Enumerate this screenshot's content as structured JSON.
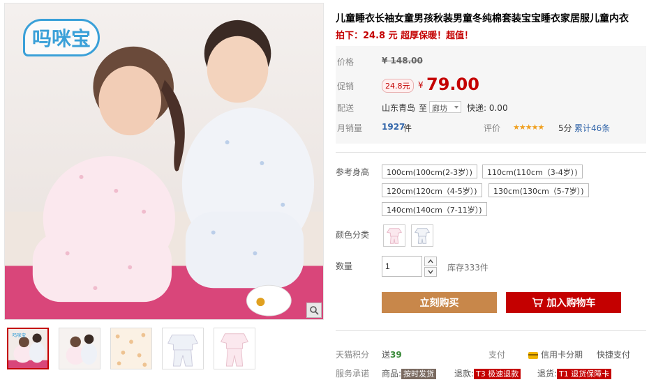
{
  "product": {
    "title": "儿童睡衣长袖女童男孩秋装男童冬纯棉套装宝宝睡衣家居服儿童内衣",
    "promo_text": "拍下：24.8 元 超厚保暖！超值！",
    "brand_logo_text": "吗咪宝"
  },
  "price": {
    "label": "价格",
    "original": "¥ 148.00",
    "promo_label": "促销",
    "promo_badge": "24.8元",
    "currency": "¥",
    "current": "79.00"
  },
  "shipping": {
    "label": "配送",
    "from": "山东青岛",
    "to_word": "至",
    "destination": "廊坊",
    "express": "快递: 0.00"
  },
  "sales": {
    "label": "月销量",
    "count": "1927",
    "unit": "件",
    "rating_label": "评价",
    "stars": "★★★★★",
    "score": "5分",
    "review_count": "累计46条"
  },
  "specs": {
    "size_label": "参考身高",
    "sizes": [
      "100cm(100cm(2-3岁）)",
      "110cm(110cm（3-4岁）)",
      "120cm(120cm（4-5岁）)",
      "130cm(130cm（5-7岁）)",
      "140cm(140cm（7-11岁）)"
    ],
    "color_label": "颜色分类",
    "colors": [
      "pink-pajama-swatch",
      "white-pajama-swatch"
    ]
  },
  "quantity": {
    "label": "数量",
    "value": "1",
    "stock": "库存333件"
  },
  "buttons": {
    "buy_now": "立刻购买",
    "add_to_cart": "加入购物车"
  },
  "footer": {
    "points_label": "天猫积分",
    "points_send": "送",
    "points_value": "39",
    "pay_label": "支付",
    "credit_card": "信用卡分期",
    "quick_pay": "快捷支付",
    "service_label": "服务承诺",
    "goods_label": "商品:",
    "goods_tag": "按时发货",
    "refund_label": "退款:",
    "refund_tag": "T3 极速退款",
    "return_label": "退货:",
    "return_tag": "T1 退货保障卡"
  },
  "colors": {
    "accent_red": "#c40000",
    "buy_button": "#c8874a",
    "logo_blue": "#3aa0d8"
  }
}
